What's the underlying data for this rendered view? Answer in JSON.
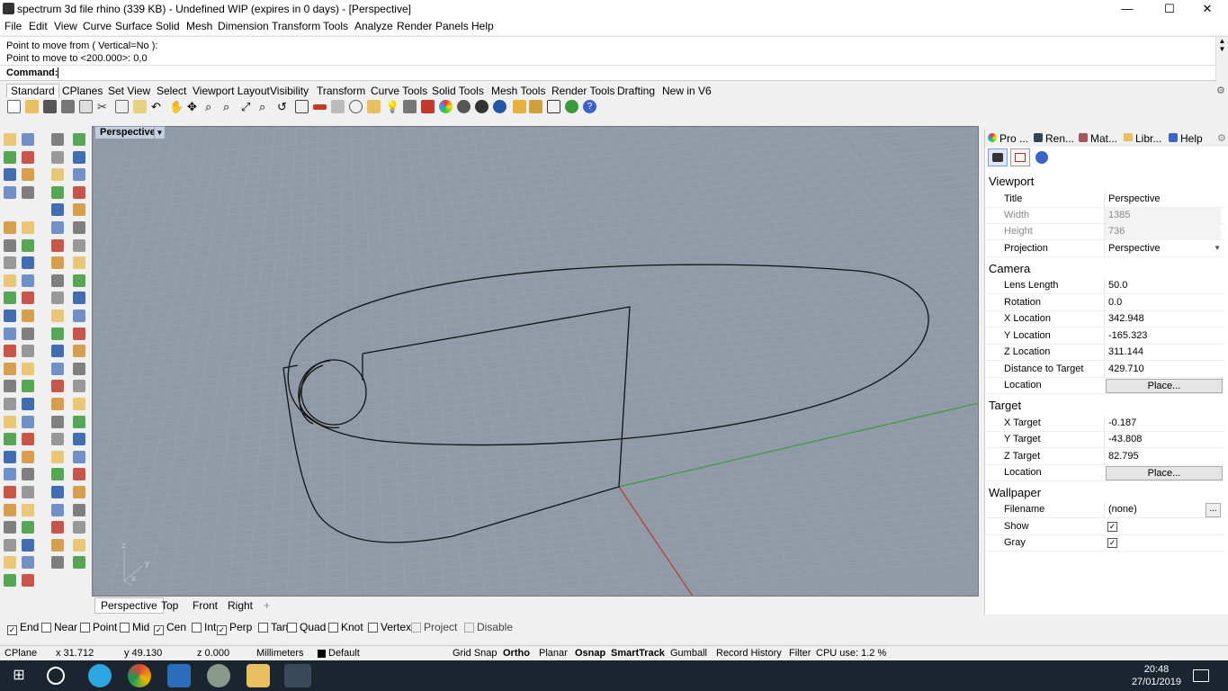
{
  "window": {
    "title": "spectrum 3d file rhino (339 KB) - Undefined WIP (expires in 0 days) - [Perspective]",
    "minimize": "—",
    "maximize": "☐",
    "close": "✕"
  },
  "menu": [
    "File",
    "Edit",
    "View",
    "Curve",
    "Surface",
    "Solid",
    "Mesh",
    "Dimension",
    "Transform",
    "Tools",
    "Analyze",
    "Render",
    "Panels",
    "Help"
  ],
  "command_history": [
    "Point to move from ( Vertical=No ):",
    "Point to move to <200.000>: 0,0"
  ],
  "command_label": "Command:",
  "toolbar_tabs": [
    "Standard",
    "CPlanes",
    "Set View",
    "Select",
    "Viewport Layout",
    "Visibility",
    "Transform",
    "Curve Tools",
    "Solid Tools",
    "Mesh Tools",
    "Render Tools",
    "Drafting",
    "New in V6"
  ],
  "viewport": {
    "label": "Perspective",
    "axis_x": "x",
    "axis_y": "y",
    "axis_z": "z",
    "tabs": [
      "Perspective",
      "Top",
      "Front",
      "Right"
    ],
    "add_tab": "+"
  },
  "panel": {
    "tabs": [
      "Pro ...",
      "Ren...",
      "Mat...",
      "Libr...",
      "Help"
    ],
    "sections": {
      "viewport": "Viewport",
      "camera": "Camera",
      "target": "Target",
      "wallpaper": "Wallpaper"
    },
    "viewport_props": {
      "title_k": "Title",
      "title_v": "Perspective",
      "width_k": "Width",
      "width_v": "1385",
      "height_k": "Height",
      "height_v": "736",
      "projection_k": "Projection",
      "projection_v": "Perspective"
    },
    "camera_props": {
      "lens_k": "Lens Length",
      "lens_v": "50.0",
      "rot_k": "Rotation",
      "rot_v": "0.0",
      "xloc_k": "X Location",
      "xloc_v": "342.948",
      "yloc_k": "Y Location",
      "yloc_v": "-165.323",
      "zloc_k": "Z Location",
      "zloc_v": "311.144",
      "dist_k": "Distance to Target",
      "dist_v": "429.710",
      "loc_k": "Location",
      "loc_btn": "Place..."
    },
    "target_props": {
      "xt_k": "X Target",
      "xt_v": "-0.187",
      "yt_k": "Y Target",
      "yt_v": "-43.808",
      "zt_k": "Z Target",
      "zt_v": "82.795",
      "loc_k": "Location",
      "loc_btn": "Place..."
    },
    "wallpaper_props": {
      "file_k": "Filename",
      "file_v": "(none)",
      "file_btn": "...",
      "show_k": "Show",
      "gray_k": "Gray"
    }
  },
  "osnaps": [
    {
      "label": "End",
      "checked": true
    },
    {
      "label": "Near",
      "checked": false
    },
    {
      "label": "Point",
      "checked": false
    },
    {
      "label": "Mid",
      "checked": false
    },
    {
      "label": "Cen",
      "checked": true
    },
    {
      "label": "Int",
      "checked": false
    },
    {
      "label": "Perp",
      "checked": true
    },
    {
      "label": "Tan",
      "checked": false
    },
    {
      "label": "Quad",
      "checked": false
    },
    {
      "label": "Knot",
      "checked": false
    },
    {
      "label": "Vertex",
      "checked": false
    },
    {
      "label": "Project",
      "checked": false
    },
    {
      "label": "Disable",
      "checked": false
    }
  ],
  "status": {
    "cplane": "CPlane",
    "x": "x 31.712",
    "y": "y 49.130",
    "z": "z 0.000",
    "units": "Millimeters",
    "layer": "Default",
    "grid_snap": "Grid Snap",
    "ortho": "Ortho",
    "planar": "Planar",
    "osnap": "Osnap",
    "smarttrack": "SmartTrack",
    "gumball": "Gumball",
    "record_history": "Record History",
    "filter": "Filter",
    "cpu": "CPU use: 1.2 %"
  },
  "taskbar": {
    "time": "20:48",
    "date": "27/01/2019"
  },
  "colors": {
    "viewport_bg": "#8f9aa6",
    "grid": "#9aa4b0",
    "x_axis": "#c0392b",
    "y_axis": "#3a9a3a",
    "curve": "#111111"
  }
}
